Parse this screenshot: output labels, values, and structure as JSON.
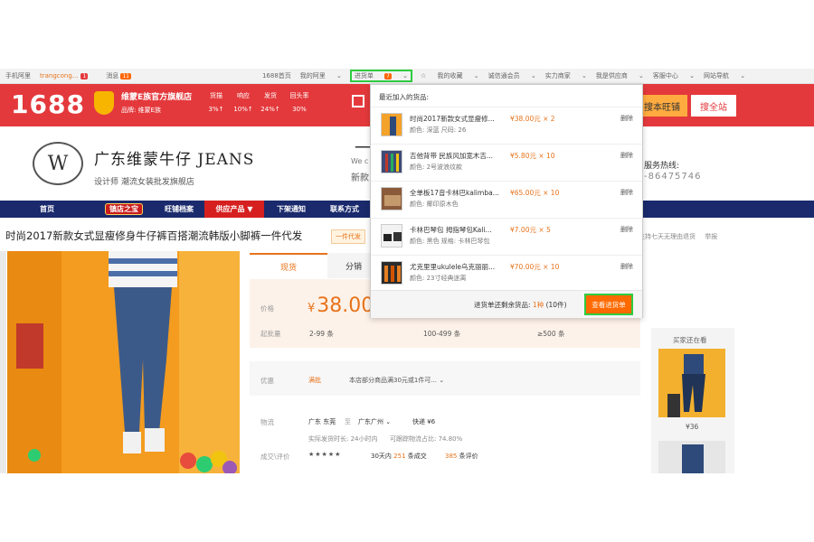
{
  "topbar": {
    "home": "手机阿里",
    "user": "trangcong...",
    "user_badge": "1",
    "messages": "消息",
    "messages_count": "11",
    "items": [
      "1688首页",
      "我的阿里",
      "进货单",
      "我的收藏",
      "诚信通会员",
      "实力商家",
      "我是供应商",
      "客服中心",
      "网站导航"
    ],
    "cart_count": "7"
  },
  "header": {
    "logo": "1688",
    "shop_name": "维蒙E族官方旗舰店",
    "shop_sub": "品牌: 维蒙E族",
    "rates": [
      {
        "label": "货描",
        "value": "3%↑"
      },
      {
        "label": "响应",
        "value": "10%↑"
      },
      {
        "label": "发货",
        "value": "24%↑"
      },
      {
        "label": "回头率",
        "value": "30%"
      }
    ],
    "wangpu_btn": "搜本旺铺",
    "site_btn": "搜全站"
  },
  "banner": {
    "brand_logo": "W",
    "title": "广东维蒙牛仔 JEANS",
    "subtitle": "设计师  潮流女装批发旗舰店",
    "dash": "一",
    "we": "We c",
    "xin": "新款",
    "hotline": "服务热线:",
    "hotline_number": "-86475746"
  },
  "nav": [
    "首页",
    "镇店之宝",
    "旺铺档案",
    "供应产品 ▼",
    "下架通知",
    "联系方式"
  ],
  "product": {
    "title": "时尚2017新款女式显瘦修身牛仔裤百搭潮流韩版小脚裤一件代发",
    "ship_tag": "一件代发",
    "service_text": "支持七天无理由退货",
    "report": "举报"
  },
  "price_panel": {
    "tabs": [
      "现货",
      "分销"
    ],
    "price_label": "价格",
    "currency": "¥",
    "price": "38.00",
    "moq_label": "起批量",
    "tiers": [
      "2-99 条",
      "100-499 条",
      "≥500 条"
    ],
    "promo_label": "优惠",
    "promo_tag": "满批",
    "promo_text": "本店部分商品满30元或1件可...",
    "logistics_label": "物流",
    "from": "广东 东莞",
    "to_label": "至",
    "to": "广东广州",
    "express": "快递 ¥6",
    "ship_time": "实际发货时长: 24小时内",
    "track_rate": "可跟踪物流占比: 74.80%",
    "review_label": "成交\\评价",
    "stars": "★★★★★",
    "deals_prefix": "30天内",
    "deals_count": "251",
    "deals_suffix": "条成交",
    "reviews_count": "385",
    "reviews_suffix": "条评价"
  },
  "also_bought": {
    "title": "买家还在看",
    "price": "¥36"
  },
  "cart_dropdown": {
    "trigger": "进货单",
    "header": "最近加入的货品:",
    "items": [
      {
        "name": "时尚2017新款女式显瘦修...",
        "spec": "颜色: 深蓝   尺码: 26",
        "price": "¥38.00元 × 2",
        "delete": "删除"
      },
      {
        "name": "吉他背带 民族风加宽木吉...",
        "spec": "颜色: 2号波浪纹款",
        "price": "¥5.80元 × 10",
        "delete": "删除"
      },
      {
        "name": "全单板17音卡林巴kalimba...",
        "spec": "颜色: 椰印原木色",
        "price": "¥65.00元 × 10",
        "delete": "删除"
      },
      {
        "name": "卡林巴琴包 拇指琴包Kali...",
        "spec": "颜色: 黑色   规格: 卡林巴琴包",
        "price": "¥7.00元 × 5",
        "delete": "删除"
      },
      {
        "name": "尤克里里ukulele乌克丽丽...",
        "spec": "颜色: 23寸经典迷离",
        "price": "¥70.00元 × 10",
        "delete": "删除"
      }
    ],
    "remain_prefix": "进货单还剩余货品:",
    "remain_kinds": "1种",
    "remain_pieces": "(10件)",
    "view_button": "查看进货单"
  },
  "colors": {
    "brand_red": "#e4393c",
    "accent_orange": "#e8731b",
    "nav_navy": "#1a2a6c",
    "highlight_green": "#2ecc40"
  }
}
